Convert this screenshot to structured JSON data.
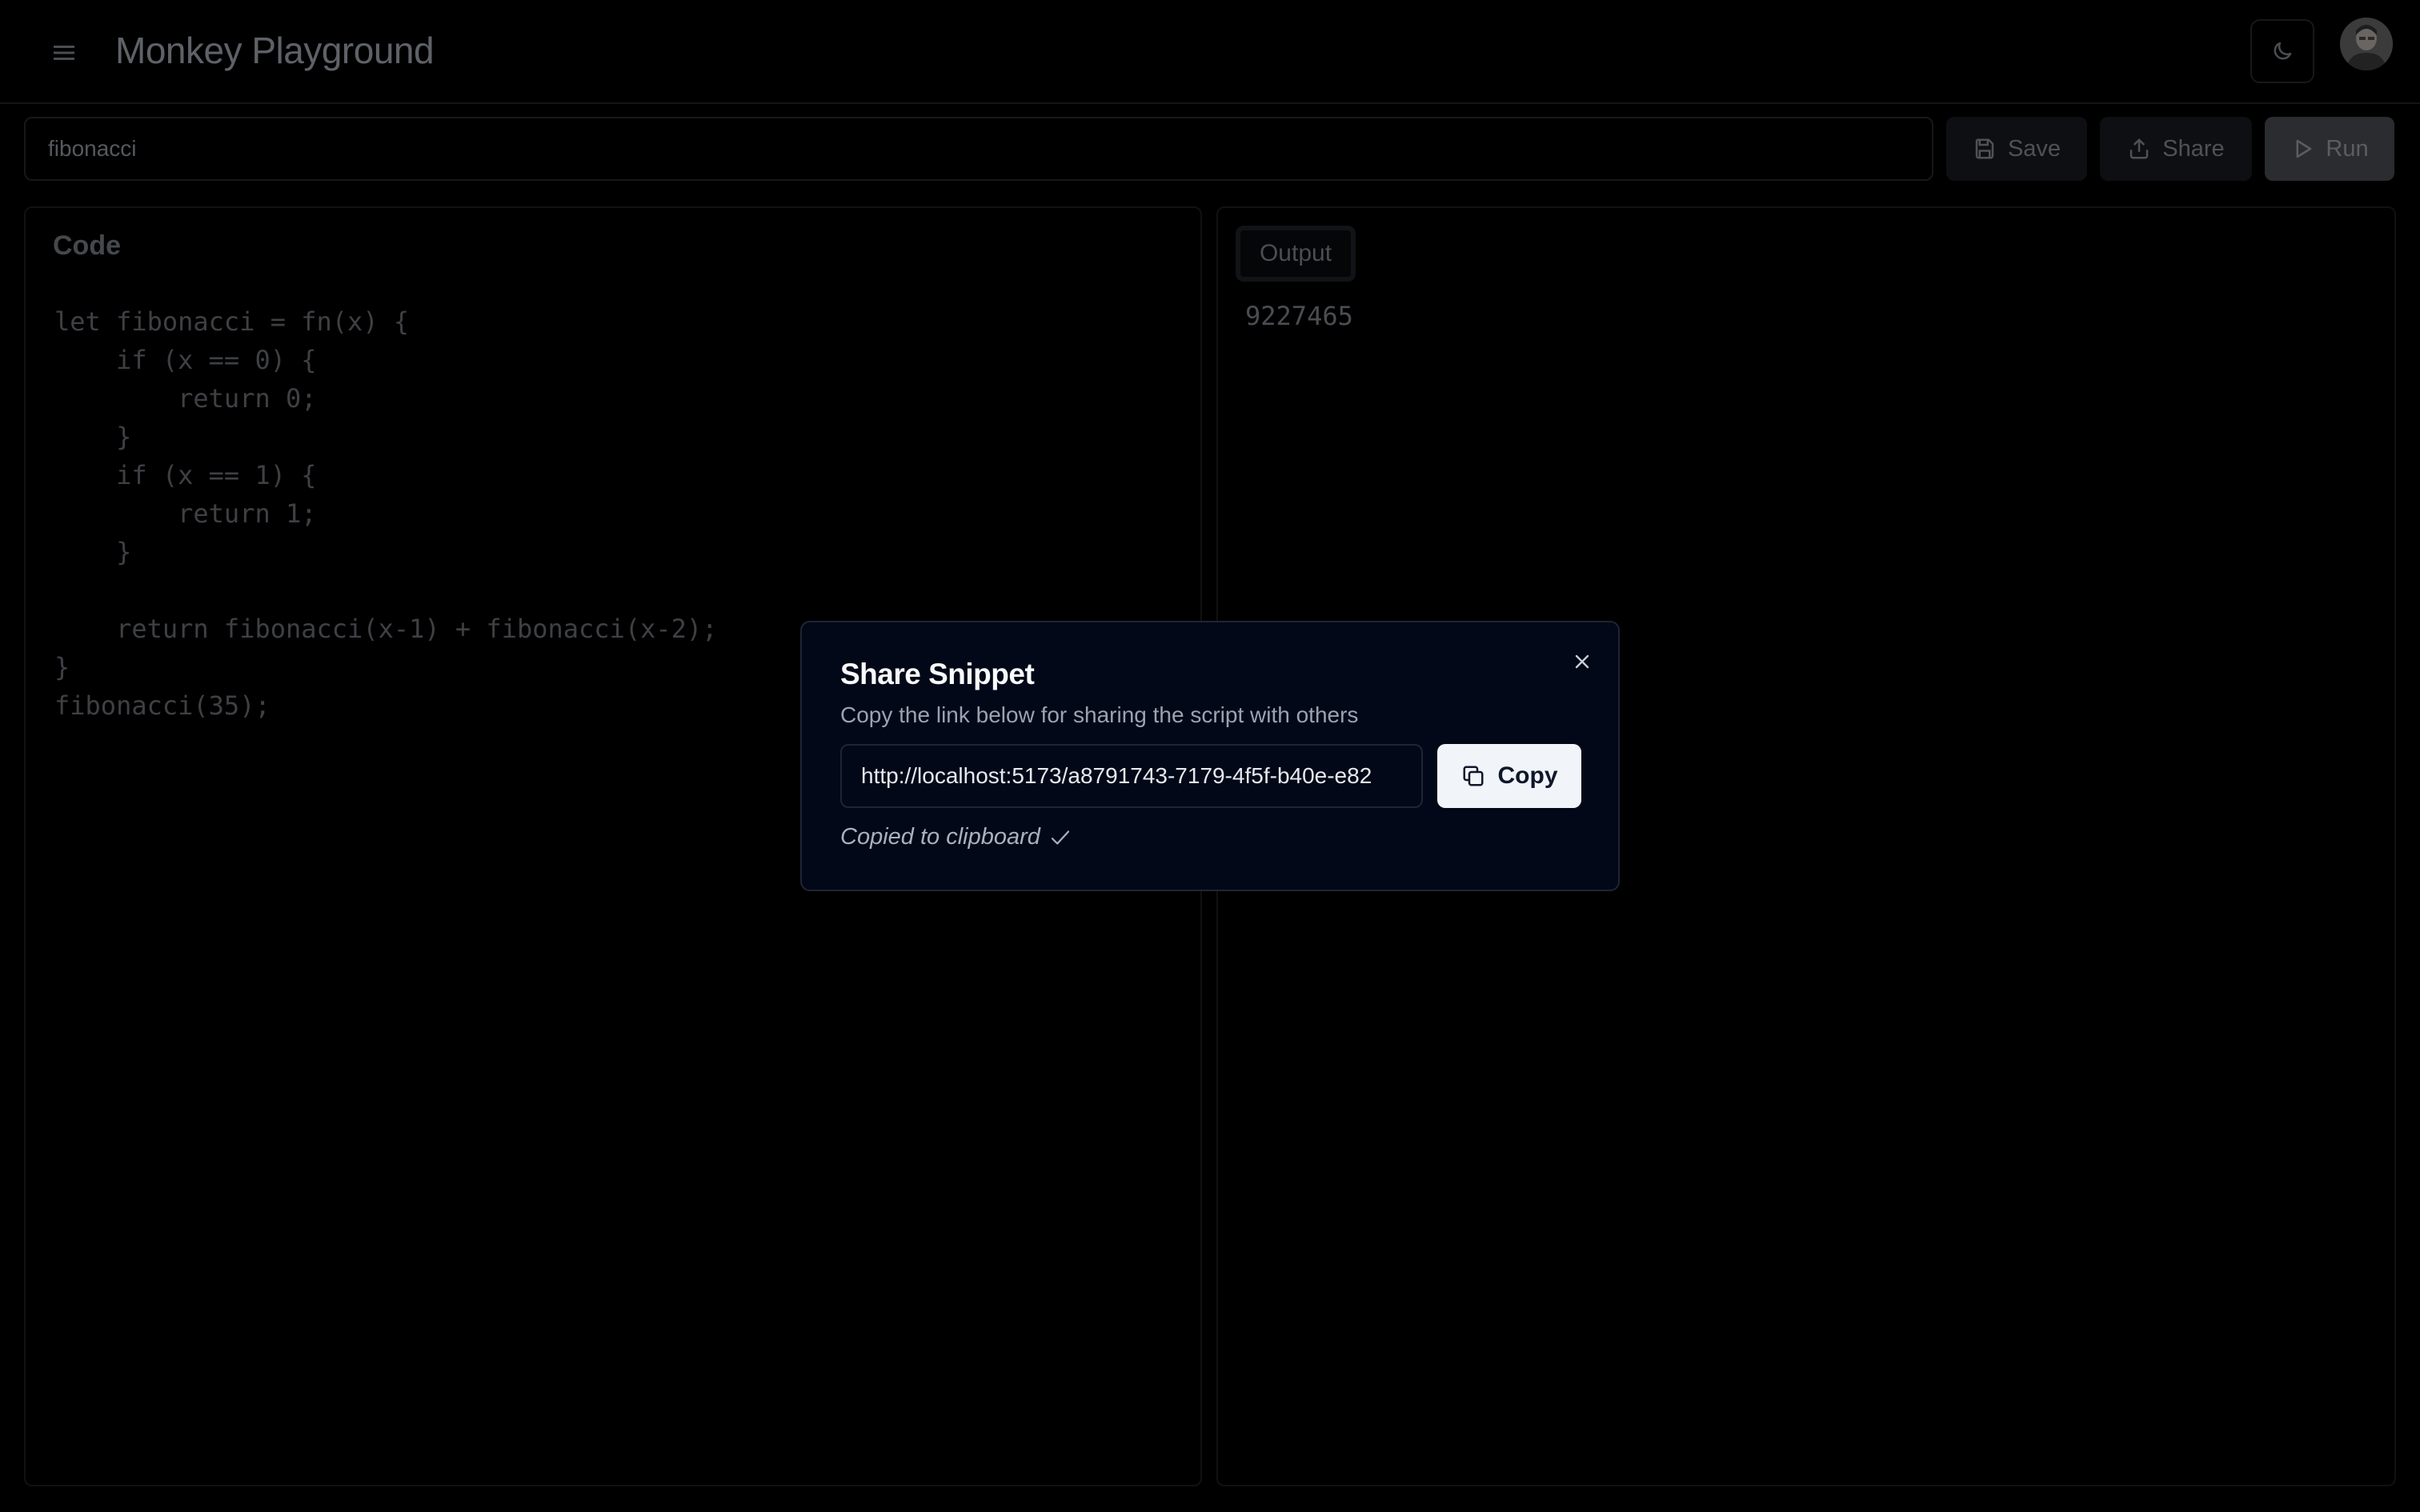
{
  "header": {
    "title": "Monkey Playground",
    "menu_icon": "hamburger-menu-icon",
    "theme_icon": "moon-icon"
  },
  "toolbar": {
    "snippet_name": "fibonacci",
    "save_label": "Save",
    "share_label": "Share",
    "run_label": "Run"
  },
  "code_panel": {
    "title": "Code",
    "lines": [
      "let fibonacci = fn(x) {",
      "    if (x == 0) {",
      "        return 0;",
      "    }",
      "    if (x == 1) {",
      "        return 1;",
      "    }",
      "",
      "    return fibonacci(x-1) + fibonacci(x-2);",
      "}",
      "fibonacci(35);"
    ]
  },
  "output_panel": {
    "tab_label": "Output",
    "value": "9227465"
  },
  "share_modal": {
    "title": "Share Snippet",
    "description": "Copy the link below for sharing the script with others",
    "link": "http://localhost:5173/a8791743-7179-4f5f-b40e-e82",
    "copy_label": "Copy",
    "copied_message": "Copied to clipboard"
  },
  "colors": {
    "background": "#000000",
    "modal_background": "#020817",
    "modal_border": "#1e2533",
    "copy_button": "#f1f5f9",
    "muted_text": "#9aa3b2"
  }
}
